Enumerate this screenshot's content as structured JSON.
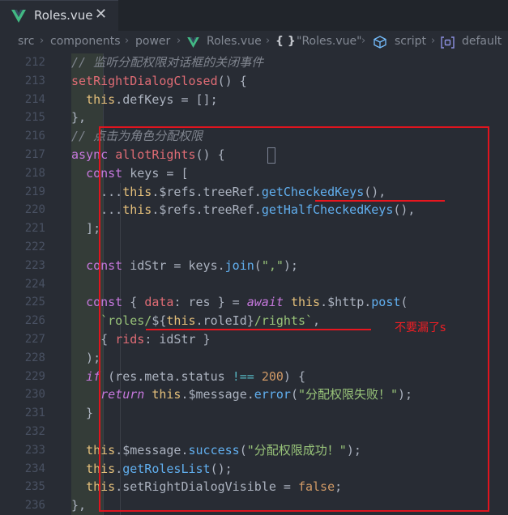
{
  "tab": {
    "title": "Roles.vue",
    "close_glyph": "✕",
    "icon": "vue-icon"
  },
  "breadcrumb": {
    "items": [
      "src",
      "components",
      "power",
      "Roles.vue",
      "{ }",
      "\"Roles.vue\"",
      "script",
      "default"
    ],
    "separator": "›"
  },
  "colors": {
    "background": "#282c34",
    "tabbar": "#21252b",
    "annotation_red": "#e0141e",
    "vue_green": "#42b883"
  },
  "annotation_note": "不要漏了s",
  "code_lines": [
    {
      "num": "212",
      "tokens": [
        [
          "cm",
          "// 监听分配权限对话框的关闭事件"
        ]
      ]
    },
    {
      "num": "213",
      "tokens": [
        [
          "fnr",
          "setRightDialogClosed"
        ],
        [
          "pl",
          "() {"
        ]
      ]
    },
    {
      "num": "214",
      "tokens": [
        [
          "pl",
          "  "
        ],
        [
          "var",
          "this"
        ],
        [
          "pl",
          ".defKeys = [];"
        ]
      ]
    },
    {
      "num": "215",
      "tokens": [
        [
          "pl",
          "},"
        ]
      ]
    },
    {
      "num": "216",
      "tokens": [
        [
          "cm",
          "// 点击为角色分配权限"
        ]
      ]
    },
    {
      "num": "217",
      "tokens": [
        [
          "kw",
          "async"
        ],
        [
          "pl",
          " "
        ],
        [
          "fnr",
          "allotRights"
        ],
        [
          "pl",
          "() {"
        ]
      ]
    },
    {
      "num": "218",
      "tokens": [
        [
          "pl",
          "  "
        ],
        [
          "kw",
          "const"
        ],
        [
          "pl",
          " keys = ["
        ]
      ]
    },
    {
      "num": "219",
      "tokens": [
        [
          "pl",
          "    ..."
        ],
        [
          "var",
          "this"
        ],
        [
          "pl",
          ".$refs.treeRef."
        ],
        [
          "fn",
          "getCheckedKeys"
        ],
        [
          "pl",
          "(),"
        ]
      ]
    },
    {
      "num": "220",
      "tokens": [
        [
          "pl",
          "    ..."
        ],
        [
          "var",
          "this"
        ],
        [
          "pl",
          ".$refs.treeRef."
        ],
        [
          "fn",
          "getHalfCheckedKeys"
        ],
        [
          "pl",
          "(),"
        ]
      ]
    },
    {
      "num": "221",
      "tokens": [
        [
          "pl",
          "  ];"
        ]
      ]
    },
    {
      "num": "222",
      "tokens": []
    },
    {
      "num": "223",
      "tokens": [
        [
          "pl",
          "  "
        ],
        [
          "kw",
          "const"
        ],
        [
          "pl",
          " idStr = keys."
        ],
        [
          "fn",
          "join"
        ],
        [
          "pl",
          "("
        ],
        [
          "str",
          "\",\""
        ],
        [
          "pl",
          ");"
        ]
      ]
    },
    {
      "num": "224",
      "tokens": []
    },
    {
      "num": "225",
      "tokens": [
        [
          "pl",
          "  "
        ],
        [
          "kw",
          "const"
        ],
        [
          "pl",
          " { "
        ],
        [
          "prop",
          "data"
        ],
        [
          "pl",
          ": res } = "
        ],
        [
          "it",
          "await"
        ],
        [
          "pl",
          " "
        ],
        [
          "var",
          "this"
        ],
        [
          "pl",
          ".$http."
        ],
        [
          "fn",
          "post"
        ],
        [
          "pl",
          "("
        ]
      ]
    },
    {
      "num": "226",
      "tokens": [
        [
          "pl",
          "    "
        ],
        [
          "str",
          "`roles/"
        ],
        [
          "pl",
          "${"
        ],
        [
          "var",
          "this"
        ],
        [
          "pl",
          ".roleId}"
        ],
        [
          "str",
          "/rights`"
        ],
        [
          "pl",
          ","
        ]
      ]
    },
    {
      "num": "227",
      "tokens": [
        [
          "pl",
          "    { "
        ],
        [
          "prop",
          "rids"
        ],
        [
          "pl",
          ": idStr }"
        ]
      ]
    },
    {
      "num": "228",
      "tokens": [
        [
          "pl",
          "  );"
        ]
      ]
    },
    {
      "num": "229",
      "tokens": [
        [
          "pl",
          "  "
        ],
        [
          "it",
          "if"
        ],
        [
          "pl",
          " (res.meta.status "
        ],
        [
          "op",
          "!=="
        ],
        [
          "pl",
          " "
        ],
        [
          "num",
          "200"
        ],
        [
          "pl",
          ") {"
        ]
      ]
    },
    {
      "num": "230",
      "tokens": [
        [
          "pl",
          "    "
        ],
        [
          "it",
          "return"
        ],
        [
          "pl",
          " "
        ],
        [
          "var",
          "this"
        ],
        [
          "pl",
          ".$message."
        ],
        [
          "fn",
          "error"
        ],
        [
          "pl",
          "("
        ],
        [
          "str",
          "\"分配权限失败！\""
        ],
        [
          "pl",
          ");"
        ]
      ]
    },
    {
      "num": "231",
      "tokens": [
        [
          "pl",
          "  }"
        ]
      ]
    },
    {
      "num": "232",
      "tokens": []
    },
    {
      "num": "233",
      "tokens": [
        [
          "pl",
          "  "
        ],
        [
          "var",
          "this"
        ],
        [
          "pl",
          ".$message."
        ],
        [
          "fn",
          "success"
        ],
        [
          "pl",
          "("
        ],
        [
          "str",
          "\"分配权限成功！\""
        ],
        [
          "pl",
          ");"
        ]
      ]
    },
    {
      "num": "234",
      "tokens": [
        [
          "pl",
          "  "
        ],
        [
          "var",
          "this"
        ],
        [
          "pl",
          "."
        ],
        [
          "fn",
          "getRolesList"
        ],
        [
          "pl",
          "();"
        ]
      ]
    },
    {
      "num": "235",
      "tokens": [
        [
          "pl",
          "  "
        ],
        [
          "var",
          "this"
        ],
        [
          "pl",
          ".setRightDialogVisible = "
        ],
        [
          "num",
          "false"
        ],
        [
          "pl",
          ";"
        ]
      ]
    },
    {
      "num": "236",
      "tokens": [
        [
          "pl",
          "},"
        ]
      ]
    }
  ]
}
